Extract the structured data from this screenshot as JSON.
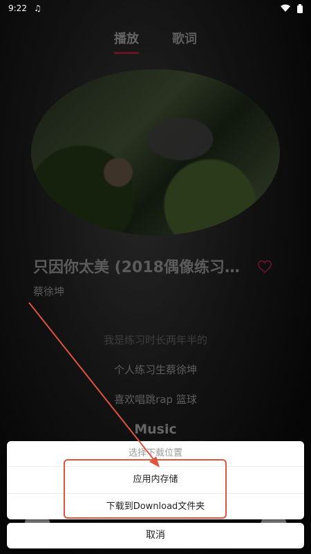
{
  "status_bar": {
    "time": "9:22",
    "music_icon": "music-note-icon",
    "wifi_icon": "wifi-icon",
    "battery_icon": "battery-icon"
  },
  "tabs": [
    {
      "label": "播放",
      "active": true
    },
    {
      "label": "歌词",
      "active": false
    }
  ],
  "song": {
    "title": "只因你太美 (2018偶像练习生...",
    "artist": "蔡徐坤"
  },
  "lyrics": [
    "我是练习时长两年半的",
    "个人练习生蔡徐坤",
    "喜欢唱跳rap 篮球",
    "Music"
  ],
  "dialog": {
    "title": "选择下载位置",
    "options": [
      "应用内存储",
      "下载到Download文件夹"
    ],
    "cancel": "取消"
  },
  "colors": {
    "accent": "#a11f3a",
    "annotation": "#e0533d"
  }
}
